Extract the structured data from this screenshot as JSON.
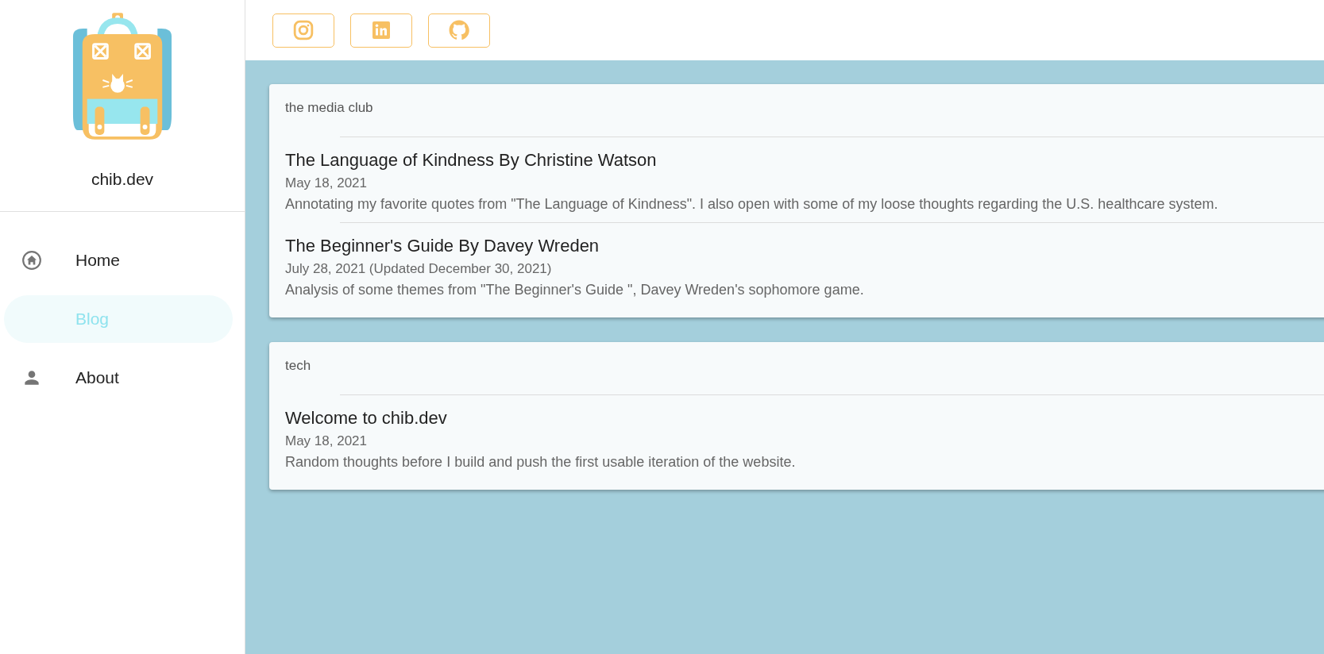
{
  "sidebar": {
    "site_name": "chib.dev",
    "nav": [
      {
        "label": "Home",
        "kind": "home",
        "selected": false
      },
      {
        "label": "Blog",
        "kind": "blog",
        "selected": true
      },
      {
        "label": "About",
        "kind": "about",
        "selected": false
      }
    ]
  },
  "social_links": [
    {
      "kind": "instagram"
    },
    {
      "kind": "linkedin"
    },
    {
      "kind": "github"
    }
  ],
  "categories": [
    {
      "name": "the media club",
      "posts": [
        {
          "title": "The Language of Kindness By Christine Watson",
          "date": "May 18, 2021",
          "summary": "Annotating my favorite quotes from \"The Language of Kindness\". I also open with some of my loose thoughts regarding the U.S. healthcare system."
        },
        {
          "title": "The Beginner's Guide By Davey Wreden",
          "date": "July 28, 2021 (Updated December 30, 2021)",
          "summary": "Analysis of some themes from \"The Beginner's Guide \", Davey Wreden's sophomore game."
        }
      ]
    },
    {
      "name": "tech",
      "posts": [
        {
          "title": "Welcome to chib.dev",
          "date": "May 18, 2021",
          "summary": "Random thoughts before I build and push the first usable iteration of the website."
        }
      ]
    }
  ]
}
